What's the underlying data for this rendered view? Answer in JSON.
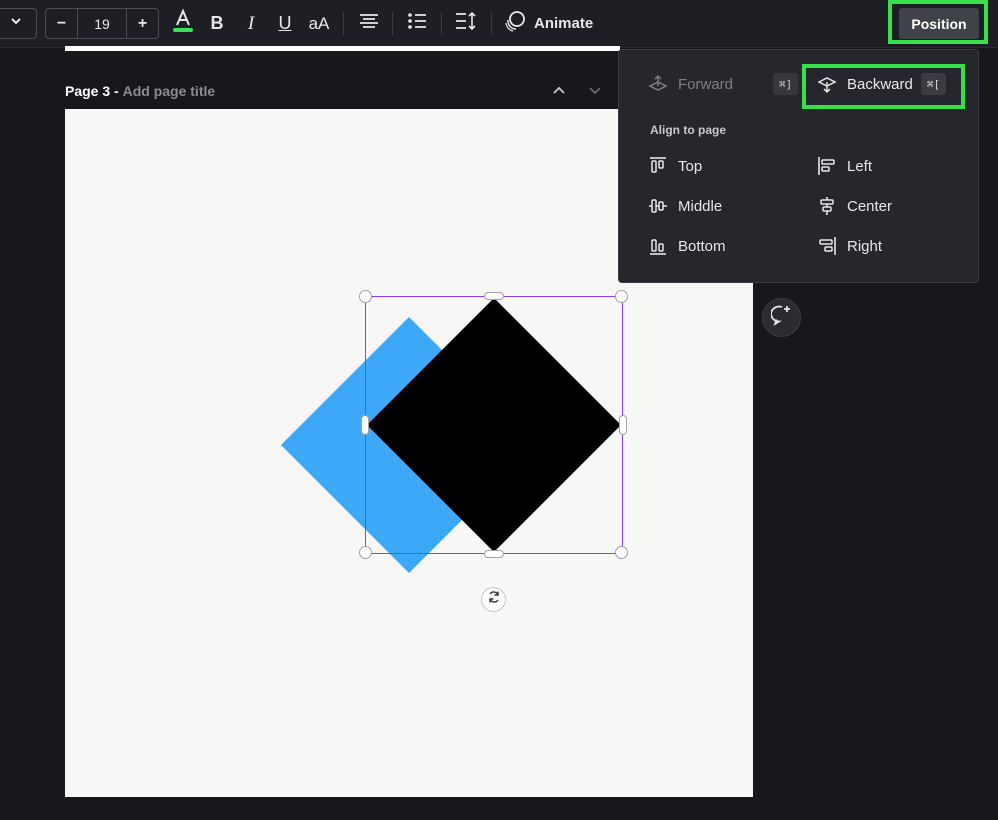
{
  "toolbar": {
    "font_size": "19",
    "decrease": "−",
    "increase": "+",
    "animate_label": "Animate",
    "position_label": "Position",
    "icons": [
      "chevron-down-icon",
      "text-color-icon",
      "bold-icon",
      "italic-icon",
      "underline-icon",
      "letter-case-icon",
      "align-center-icon",
      "bullet-list-icon",
      "line-spacing-icon",
      "animate-icon"
    ],
    "text_color_underline": "#3ee05a",
    "highlight_color": "#35e04a"
  },
  "page": {
    "number": "Page 3 -",
    "title_placeholder": "Add page title"
  },
  "canvas": {
    "background": "#f7f7f5",
    "shapes": [
      {
        "name": "blue-diamond",
        "color": "#3ea8f8"
      },
      {
        "name": "black-diamond",
        "color": "#000000"
      }
    ],
    "selection_color": "#8b3dff"
  },
  "position_menu": {
    "forward": {
      "label": "Forward",
      "shortcut": "⌘]"
    },
    "backward": {
      "label": "Backward",
      "shortcut": "⌘["
    },
    "align_title": "Align to page",
    "align": {
      "top": "Top",
      "left": "Left",
      "middle": "Middle",
      "center": "Center",
      "bottom": "Bottom",
      "right": "Right"
    }
  }
}
